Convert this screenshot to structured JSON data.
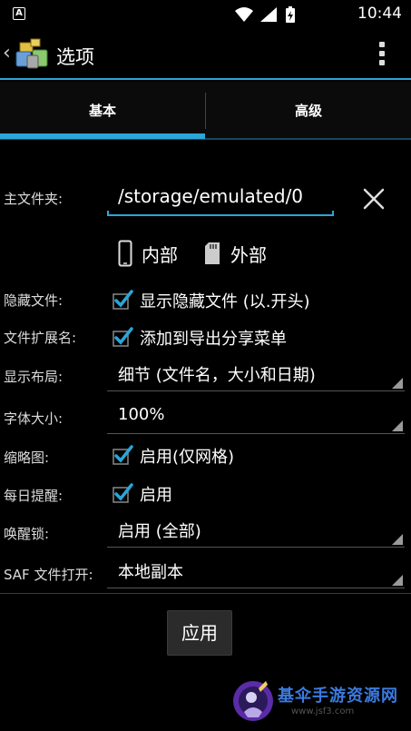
{
  "status_bar": {
    "notification_letter": "A",
    "time": "10:44",
    "icons": [
      "wifi-icon",
      "signal-icon",
      "battery-icon"
    ]
  },
  "action_bar": {
    "title": "选项",
    "back_icon": "chevron-left-icon",
    "overflow_icon": "more-vert-icon"
  },
  "tabs": [
    {
      "label": "基本",
      "selected": true
    },
    {
      "label": "高级",
      "selected": false
    }
  ],
  "main_folder": {
    "label": "主文件夹:",
    "value": "/storage/emulated/0",
    "clear_icon": "close-icon"
  },
  "storage": {
    "internal_label": "内部",
    "external_label": "外部"
  },
  "settings": {
    "hidden_files": {
      "label": "隐藏文件:",
      "checkbox_text": "显示隐藏文件 (以.开头)",
      "checked": true
    },
    "file_extension": {
      "label": "文件扩展名:",
      "checkbox_text": "添加到导出分享菜单",
      "checked": true
    },
    "display_layout": {
      "label": "显示布局:",
      "value": "细节 (文件名，大小和日期)"
    },
    "font_size": {
      "label": "字体大小:",
      "value": "100%"
    },
    "thumbnails": {
      "label": "缩略图:",
      "checkbox_text": "启用(仅网格)",
      "checked": true
    },
    "daily_reminder": {
      "label": "每日提醒:",
      "checkbox_text": "启用",
      "checked": true
    },
    "wake_lock": {
      "label": "唤醒锁:",
      "value": "启用 (全部)"
    },
    "saf_open": {
      "label": "SAF 文件打开:",
      "value": "本地副本"
    }
  },
  "apply_button": "应用",
  "watermark": {
    "text": "基伞手游资源网",
    "url": "www.jsf3.com"
  },
  "colors": {
    "accent": "#2aa6d8",
    "background": "#000000",
    "watermark_blue": "#3b7be0"
  }
}
